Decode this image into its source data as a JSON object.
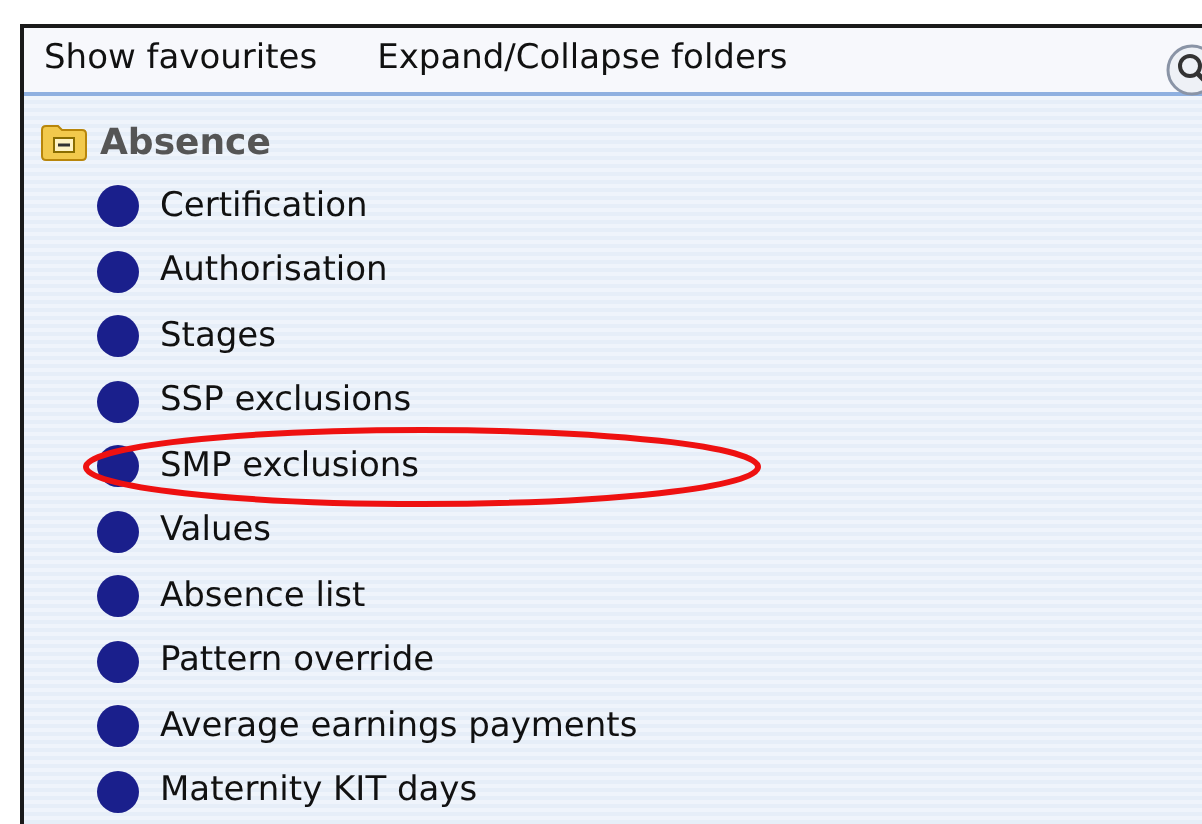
{
  "toolbar": {
    "items": [
      "Show favourites",
      "Expand/Collapse folders"
    ]
  },
  "tree": {
    "label": "Absence",
    "expanded": true,
    "children": [
      {
        "label": "Certification",
        "circled": false
      },
      {
        "label": "Authorisation",
        "circled": false
      },
      {
        "label": "Stages",
        "circled": false
      },
      {
        "label": "SSP exclusions",
        "circled": false
      },
      {
        "label": "SMP exclusions",
        "circled": true
      },
      {
        "label": "Values",
        "circled": false
      },
      {
        "label": "Absence list",
        "circled": false
      },
      {
        "label": "Pattern override",
        "circled": false
      },
      {
        "label": "Average earnings payments",
        "circled": false
      },
      {
        "label": "Maternity KIT days",
        "circled": false
      }
    ]
  }
}
